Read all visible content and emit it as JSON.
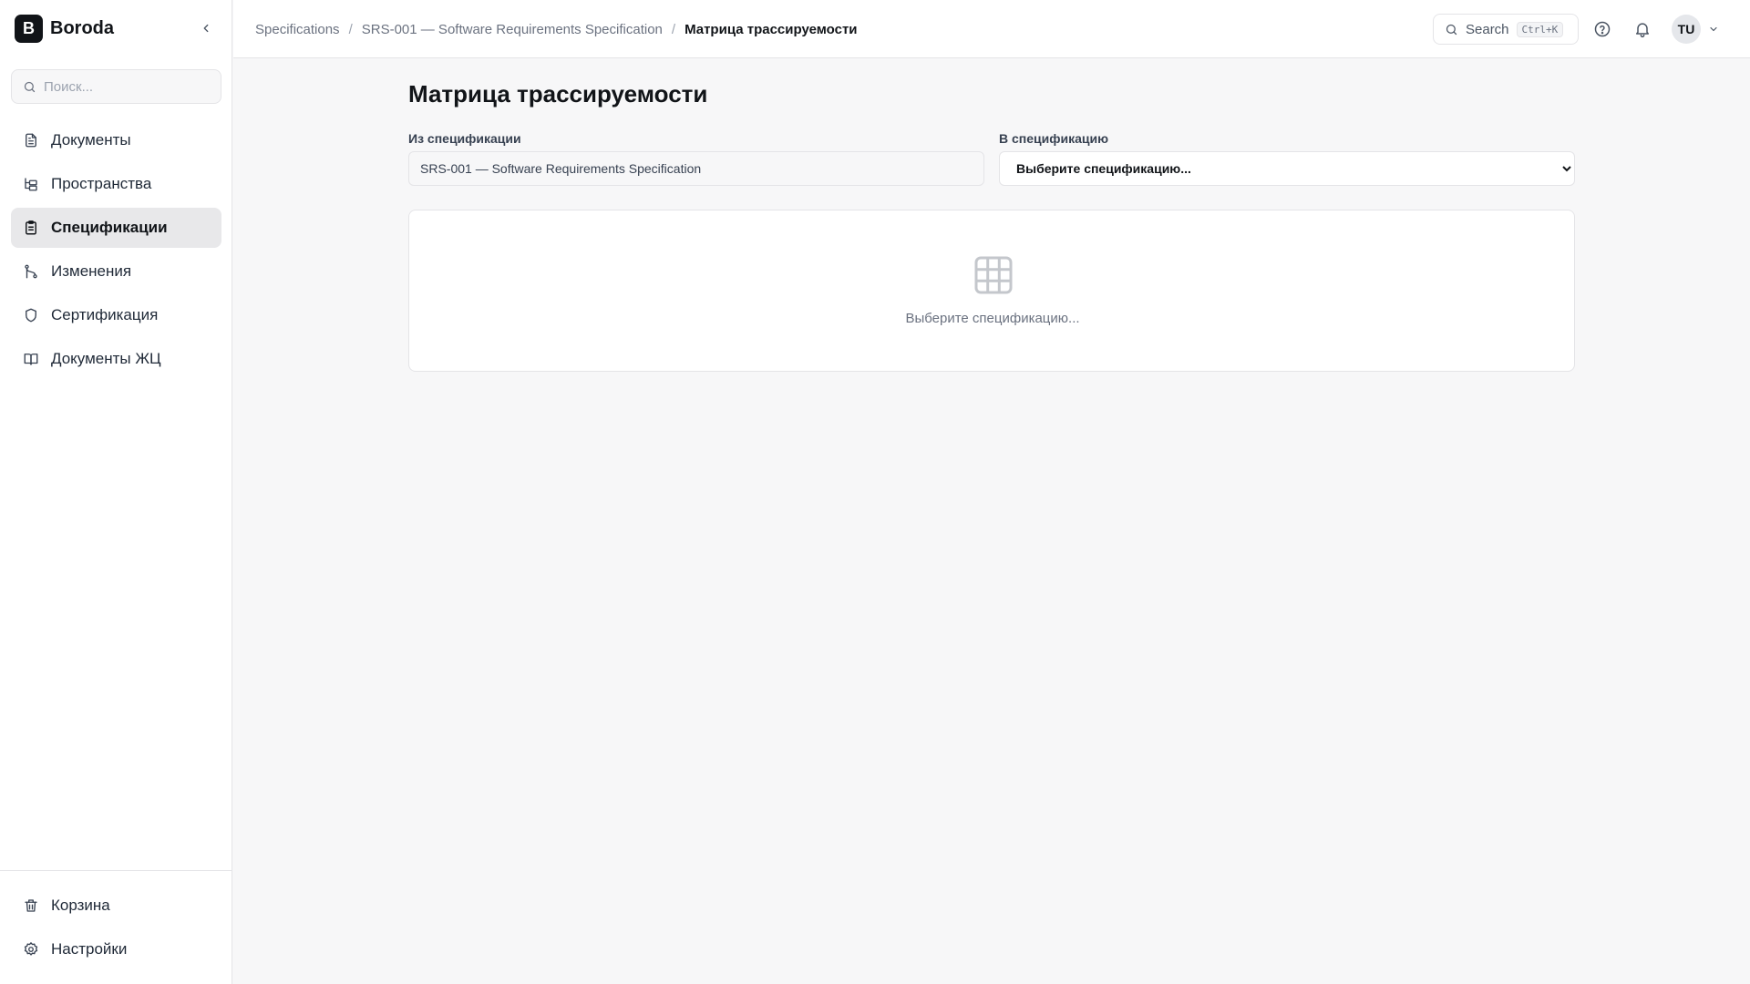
{
  "app": {
    "logo_letter": "B",
    "name": "Boroda"
  },
  "sidebar": {
    "search_placeholder": "Поиск...",
    "items": [
      {
        "label": "Документы",
        "icon": "document-icon",
        "active": false
      },
      {
        "label": "Пространства",
        "icon": "spaces-tree-icon",
        "active": false
      },
      {
        "label": "Спецификации",
        "icon": "clipboard-icon",
        "active": true
      },
      {
        "label": "Изменения",
        "icon": "git-branch-icon",
        "active": false
      },
      {
        "label": "Сертификация",
        "icon": "shield-icon",
        "active": false
      },
      {
        "label": "Документы ЖЦ",
        "icon": "book-icon",
        "active": false
      }
    ],
    "bottom_items": [
      {
        "label": "Корзина",
        "icon": "trash-icon"
      },
      {
        "label": "Настройки",
        "icon": "gear-icon"
      }
    ]
  },
  "breadcrumb": {
    "items": [
      "Specifications",
      "SRS-001 — Software Requirements Specification"
    ],
    "separator": "/",
    "current": "Матрица трассируемости"
  },
  "topbar": {
    "search_label": "Search",
    "search_shortcut": "Ctrl+K",
    "avatar_initials": "TU"
  },
  "main": {
    "title": "Матрица трассируемости",
    "from_label": "Из спецификации",
    "from_value": "SRS-001 — Software Requirements Specification",
    "to_label": "В спецификацию",
    "to_selected": "Выберите спецификацию...",
    "empty_text": "Выберите спецификацию..."
  },
  "colors": {
    "accent": "#111418",
    "active_bg": "#e8e8ea",
    "border": "#e4e4e7",
    "muted_text": "#6b7280",
    "page_bg": "#f7f7f8"
  }
}
